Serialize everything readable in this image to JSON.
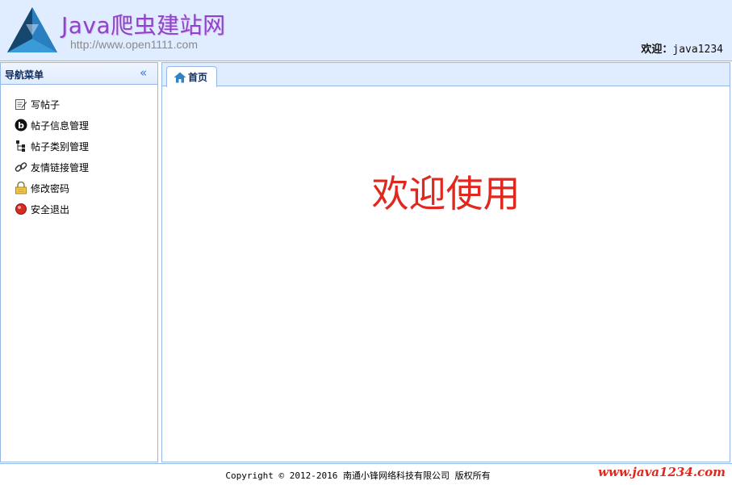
{
  "header": {
    "logo_title": "Java爬虫建站网",
    "logo_url": "http://www.open1111.com",
    "welcome_label": "欢迎：",
    "username": "java1234"
  },
  "nav": {
    "title": "导航菜单",
    "collapse_glyph": "«",
    "items": [
      {
        "label": "写帖子",
        "icon": "edit-icon"
      },
      {
        "label": "帖子信息管理",
        "icon": "blog-icon"
      },
      {
        "label": "帖子类别管理",
        "icon": "tree-icon"
      },
      {
        "label": "友情链接管理",
        "icon": "link-icon"
      },
      {
        "label": "修改密码",
        "icon": "lock-icon"
      },
      {
        "label": "安全退出",
        "icon": "exit-icon"
      }
    ]
  },
  "tabs": [
    {
      "label": "首页",
      "icon": "home-icon"
    }
  ],
  "main": {
    "welcome_text": "欢迎使用"
  },
  "footer": {
    "copyright": "Copyright © 2012-2016 南通小锋网络科技有限公司 版权所有",
    "watermark": "www.java1234.com"
  },
  "colors": {
    "header_bg": "#e0ecff",
    "border": "#95b8e7",
    "accent_red": "#e0281f",
    "logo_purple": "#8e44c8"
  }
}
